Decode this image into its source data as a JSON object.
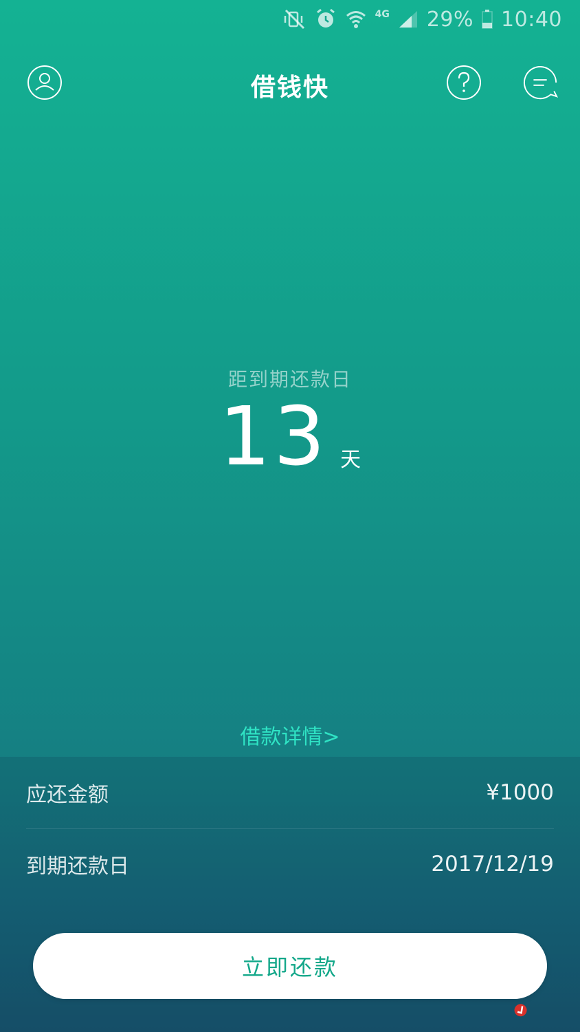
{
  "status_bar": {
    "icons": [
      "mute-vibrate-icon",
      "alarm-icon",
      "wifi-icon",
      "signal-icon",
      "battery-icon"
    ],
    "network": "4G",
    "battery": "29%",
    "time": "10:40"
  },
  "header": {
    "title": "借钱快",
    "icons": [
      "user-profile-icon",
      "help-icon",
      "message-icon"
    ]
  },
  "countdown": {
    "label": "距到期还款日",
    "value": "13",
    "unit": "天"
  },
  "detail_link": "借款详情>",
  "info": {
    "rows": [
      {
        "label": "应还金额",
        "value": "¥1000"
      },
      {
        "label": "到期还款日",
        "value": "2017/12/19"
      }
    ]
  },
  "repay_button": "立即还款",
  "colors": {
    "gradient_top": "#14b293",
    "gradient_bottom": "#17566f",
    "accent_link": "#2fe3c4",
    "button_text": "#12a789",
    "button_bg": "#ffffff"
  }
}
